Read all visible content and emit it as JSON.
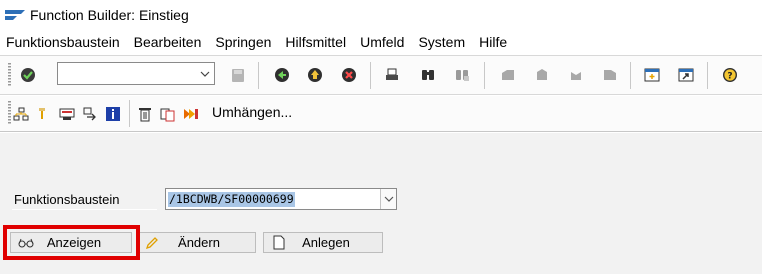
{
  "window": {
    "title": "Function Builder: Einstieg"
  },
  "menubar": {
    "items": [
      "Funktionsbaustein",
      "Bearbeiten",
      "Springen",
      "Hilfsmittel",
      "Umfeld",
      "System",
      "Hilfe"
    ]
  },
  "toolbar": {
    "command_field_value": "",
    "icons": [
      "enter-icon",
      "save-icon",
      "back-icon",
      "exit-icon",
      "cancel-icon",
      "print-icon",
      "find-icon",
      "find-next-icon",
      "first-page-icon",
      "previous-page-icon",
      "next-page-icon",
      "last-page-icon",
      "new-session-icon",
      "shortcut-icon",
      "help-icon"
    ]
  },
  "app_toolbar": {
    "icons": [
      "where-used-icon",
      "other-object-icon",
      "test-icon",
      "reassign-icon",
      "info-icon",
      "delete-icon",
      "copy-icon",
      "rename-icon"
    ],
    "umhaengen_label": "Umhängen..."
  },
  "form": {
    "field_label": "Funktionsbaustein",
    "field_value": "/1BCDWB/SF00000699"
  },
  "buttons": {
    "display_label": "Anzeigen",
    "change_label": "Ändern",
    "create_label": "Anlegen"
  },
  "colors": {
    "highlight": "#e00000",
    "selection": "#a9c6e6",
    "sap_blue": "#2d6fb7"
  }
}
